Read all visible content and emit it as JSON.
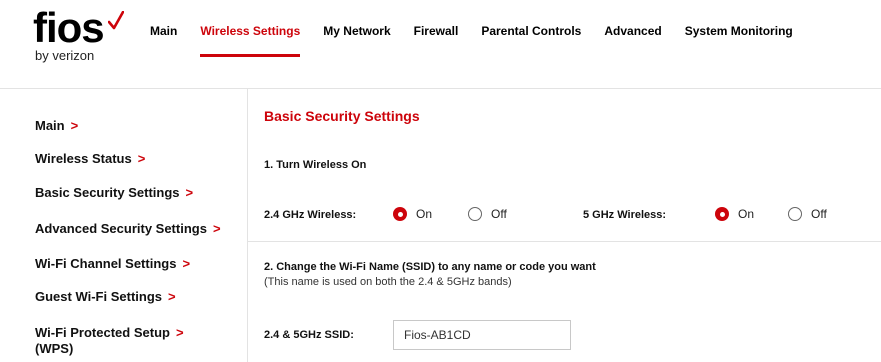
{
  "brand": {
    "logo_word": "fios",
    "logo_sub": "by verizon",
    "accent": "#cd040b"
  },
  "nav": {
    "items": [
      {
        "label": "Main"
      },
      {
        "label": "Wireless Settings",
        "active": true
      },
      {
        "label": "My Network"
      },
      {
        "label": "Firewall"
      },
      {
        "label": "Parental Controls"
      },
      {
        "label": "Advanced"
      },
      {
        "label": "System Monitoring"
      }
    ]
  },
  "sidebar": {
    "items": [
      {
        "label": "Main"
      },
      {
        "label": "Wireless Status"
      },
      {
        "label": "Basic Security Settings"
      },
      {
        "label": "Advanced Security Settings"
      },
      {
        "label": "Wi-Fi Channel Settings"
      },
      {
        "label": "Guest Wi-Fi Settings"
      },
      {
        "label": "Wi-Fi Protected Setup",
        "label2": "(WPS)"
      }
    ],
    "chevron": ">"
  },
  "main": {
    "title": "Basic Security Settings",
    "step1": "1. Turn Wireless On",
    "wireless24": {
      "label": "2.4 GHz Wireless:",
      "on_label": "On",
      "off_label": "Off",
      "selected": "On"
    },
    "wireless5": {
      "label": "5 GHz Wireless:",
      "on_label": "On",
      "off_label": "Off",
      "selected": "On"
    },
    "step2": "2. Change the Wi-Fi Name (SSID) to any name or code you want",
    "step2_note": "(This name is used on both the 2.4 & 5GHz bands)",
    "ssid": {
      "label": "2.4 & 5GHz SSID:",
      "value": "Fios-AB1CD"
    }
  }
}
